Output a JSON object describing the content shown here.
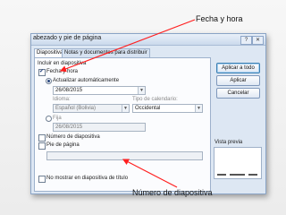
{
  "dialog": {
    "title": "abezado y pie de página",
    "close_label": "✕",
    "help_label": "?"
  },
  "tabs": [
    {
      "label": "Diapositiva",
      "active": true
    },
    {
      "label": "Notas y documentos para distribuir",
      "active": false
    }
  ],
  "include_label": "Incluir en diapositiva",
  "date_time": {
    "label": "Fecha y hora",
    "checked": true,
    "auto_label": "Actualizar automáticamente",
    "auto_value": "26/08/2015",
    "language_label": "Idioma:",
    "language_value": "Español (Bolivia)",
    "calendar_label": "Tipo de calendario:",
    "calendar_value": "Occidental",
    "fixed_label": "Fija",
    "fixed_value": "26/08/2015"
  },
  "slide_number": {
    "label": "Número de diapositiva",
    "checked": false
  },
  "footer": {
    "label": "Pie de página",
    "checked": false,
    "value": ""
  },
  "title_slide": {
    "label": "No mostrar en diapositiva de título",
    "checked": false
  },
  "buttons": {
    "apply_all": "Aplicar a todo",
    "apply": "Aplicar",
    "cancel": "Cancelar"
  },
  "preview_label": "Vista previa",
  "callouts": {
    "top": "Fecha y hora",
    "bottom": "Número de diapositiva"
  },
  "colors": {
    "arrow": "#ff1f1f",
    "accent": "#3c7fb1"
  }
}
